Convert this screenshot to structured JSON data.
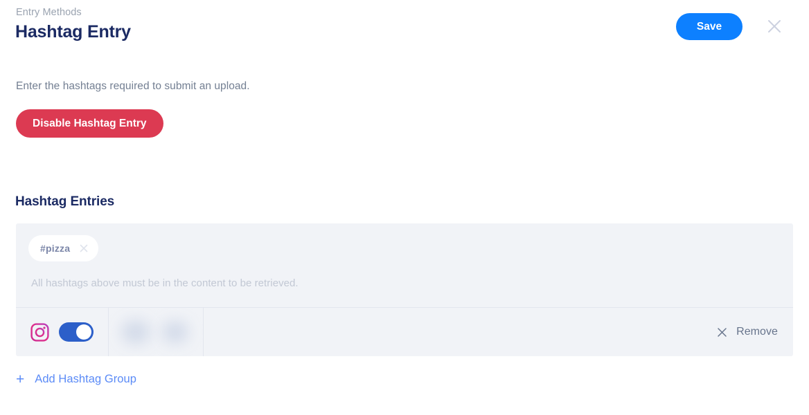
{
  "header": {
    "breadcrumb": "Entry Methods",
    "title": "Hashtag Entry",
    "save_label": "Save",
    "close_icon": "close-icon"
  },
  "body": {
    "description": "Enter the hashtags required to submit an upload.",
    "disable_button_label": "Disable Hashtag Entry",
    "section_title": "Hashtag Entries"
  },
  "panel": {
    "chips": [
      {
        "label": "#pizza",
        "remove_icon": "close-icon"
      }
    ],
    "hint": "All hashtags above must be in the content to be retrieved.",
    "row": {
      "network_icon": "instagram-icon",
      "toggle_state": "on",
      "remove_label": "Remove",
      "remove_icon": "close-icon"
    }
  },
  "footer": {
    "add_icon": "plus-icon",
    "add_label": "Add Hashtag Group"
  },
  "colors": {
    "save_blue": "#0d80ff",
    "disable_red": "#dc3a52",
    "title_navy": "#1b2a63",
    "panel_bg": "#f1f3f7",
    "toggle_blue": "#2c5fc9",
    "link_blue": "#5b8bf7"
  }
}
